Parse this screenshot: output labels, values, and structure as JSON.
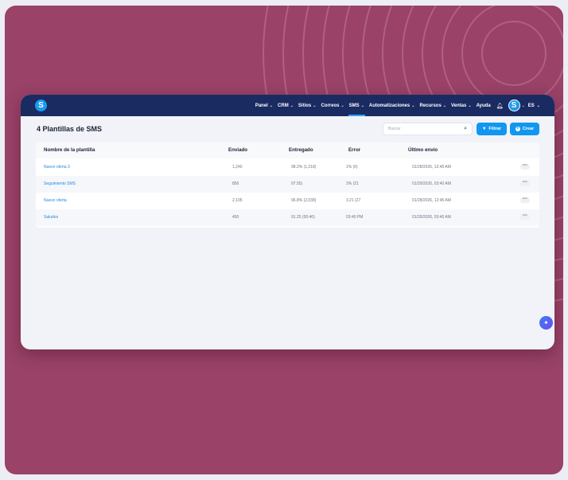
{
  "nav": {
    "items": [
      {
        "label": "Panel",
        "has_menu": true
      },
      {
        "label": "CRM",
        "has_menu": true
      },
      {
        "label": "Sitios",
        "has_menu": true
      },
      {
        "label": "Correos",
        "has_menu": true
      },
      {
        "label": "SMS",
        "has_menu": true,
        "active": true
      },
      {
        "label": "Automatizaciones",
        "has_menu": true
      },
      {
        "label": "Recursos",
        "has_menu": true
      },
      {
        "label": "Ventas",
        "has_menu": true
      },
      {
        "label": "Ayuda",
        "has_menu": false
      }
    ],
    "logo_letter": "S",
    "avatar_letter": "S",
    "language": "ES"
  },
  "page": {
    "title": "4 Plantillas de SMS"
  },
  "search": {
    "placeholder": "Buscar"
  },
  "actions": {
    "filter_label": "Filtrar",
    "create_label": "Crear"
  },
  "table": {
    "columns": [
      "Nombre de la plantilla",
      "Enviado",
      "Entregado",
      "Error",
      "Último envío"
    ],
    "rows": [
      {
        "name": "Nuevo oferta 3",
        "sent": "1,240",
        "delivered": "98.2% (1,218)",
        "error": "1% (0)",
        "last": "01/28/2026, 12:45 AM"
      },
      {
        "name": "Seguimiento SMS",
        "sent": "856",
        "delivered": "97.55)",
        "error": "2% (21",
        "last": "01/29/2026, 03:40 AM"
      },
      {
        "name": "Nuevo oferta",
        "sent": "2,105",
        "delivered": "96.8% (2,038)",
        "error": "3.21 (27",
        "last": "01/28/2026, 12:45 AM"
      },
      {
        "name": "Saludos",
        "sent": "450",
        "delivered": "91.25 (00:46)",
        "error": "03:40 PM",
        "last": "01/29/2026, 03:40 AM"
      }
    ]
  },
  "colors": {
    "frame": "#9a4268",
    "nav": "#1a2b62",
    "accent": "#1197ef",
    "link": "#1e88e5"
  }
}
